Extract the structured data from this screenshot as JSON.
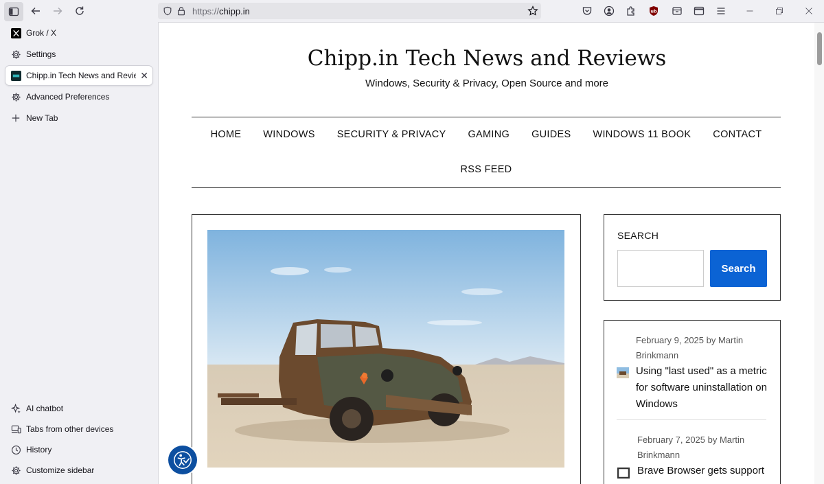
{
  "browser": {
    "url_protocol": "https://",
    "url_host": "chipp.in"
  },
  "sidebar": {
    "tabs": [
      {
        "label": "Grok / X",
        "icon": "x-logo-icon"
      },
      {
        "label": "Settings",
        "icon": "gear-icon"
      },
      {
        "label": "Chipp.in Tech News and Reviews",
        "icon": "chipp-favicon-icon",
        "active": true
      },
      {
        "label": "Advanced Preferences",
        "icon": "gear-icon"
      },
      {
        "label": "New Tab",
        "icon": "plus-icon"
      }
    ],
    "tools": [
      {
        "label": "AI chatbot",
        "icon": "sparkle-icon"
      },
      {
        "label": "Tabs from other devices",
        "icon": "devices-icon"
      },
      {
        "label": "History",
        "icon": "clock-icon"
      },
      {
        "label": "Customize sidebar",
        "icon": "gear-icon"
      }
    ]
  },
  "site": {
    "title": "Chipp.in Tech News and Reviews",
    "tagline": "Windows, Security & Privacy, Open Source and more",
    "nav_row1": [
      "HOME",
      "WINDOWS",
      "SECURITY & PRIVACY",
      "GAMING",
      "GUIDES",
      "WINDOWS 11 BOOK",
      "CONTACT"
    ],
    "nav_row2": [
      "RSS FEED"
    ]
  },
  "search_widget": {
    "label": "SEARCH",
    "button": "Search",
    "placeholder": ""
  },
  "recent_posts": [
    {
      "meta": "February 9, 2025 by Martin Brinkmann",
      "title": "Using \"last used\" as a metric for software uninstallation on Windows"
    },
    {
      "meta": "February 7, 2025 by Martin Brinkmann",
      "title": "Brave Browser gets support"
    }
  ],
  "colors": {
    "search_button": "#0b63d4",
    "accessibility_button": "#0d4fa0"
  }
}
